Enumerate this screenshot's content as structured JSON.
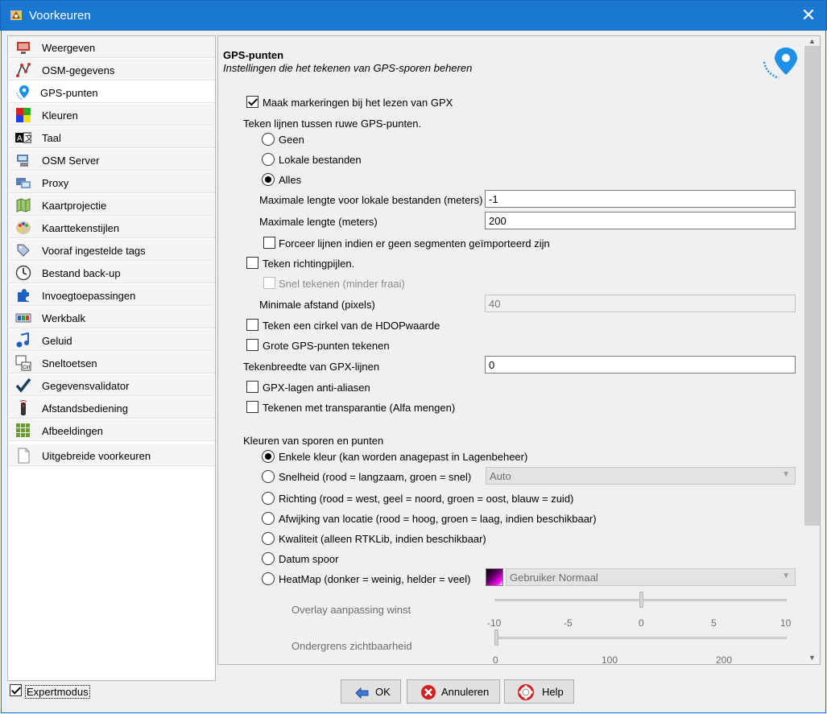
{
  "window": {
    "title": "Voorkeuren",
    "close_glyph": "✕"
  },
  "sidebar": {
    "items": [
      {
        "label": "Weergeven",
        "icon": "display-icon"
      },
      {
        "label": "OSM-gegevens",
        "icon": "osm-data-icon"
      },
      {
        "label": "GPS-punten",
        "icon": "gps-pin-icon"
      },
      {
        "label": "Kleuren",
        "icon": "colors-icon"
      },
      {
        "label": "Taal",
        "icon": "language-icon"
      },
      {
        "label": "OSM Server",
        "icon": "server-icon"
      },
      {
        "label": "Proxy",
        "icon": "proxy-icon"
      },
      {
        "label": "Kaartprojectie",
        "icon": "map-projection-icon"
      },
      {
        "label": "Kaarttekenstijlen",
        "icon": "palette-icon"
      },
      {
        "label": "Vooraf ingestelde tags",
        "icon": "tags-icon"
      },
      {
        "label": "Bestand back-up",
        "icon": "clock-icon"
      },
      {
        "label": "Invoegtoepassingen",
        "icon": "plugin-icon"
      },
      {
        "label": "Werkbalk",
        "icon": "toolbar-icon"
      },
      {
        "label": "Geluid",
        "icon": "sound-icon"
      },
      {
        "label": "Sneltoetsen",
        "icon": "shortcuts-icon"
      },
      {
        "label": "Gegevensvalidator",
        "icon": "validator-check-icon"
      },
      {
        "label": "Afstandsbediening",
        "icon": "remote-control-icon"
      },
      {
        "label": "Afbeeldingen",
        "icon": "imagery-grid-icon"
      },
      {
        "label": "Uitgebreide voorkeuren",
        "icon": "document-icon"
      }
    ],
    "selected": "GPS-punten"
  },
  "panel": {
    "title": "GPS-punten",
    "subtitle": "Instellingen die het tekenen van GPS-sporen beheren",
    "make_markers": "Maak markeringen bij het lezen van GPX",
    "draw_lines_heading": "Teken lijnen tussen ruwe GPS-punten.",
    "lines_none": "Geen",
    "lines_local": "Lokale bestanden",
    "lines_all": "Alles",
    "max_len_local_label": "Maximale lengte voor lokale bestanden (meters)",
    "max_len_local_value": "-1",
    "max_len_label": "Maximale lengte (meters)",
    "max_len_value": "200",
    "force_lines": "Forceer lijnen indien er geen segmenten geïmporteerd zijn",
    "draw_arrows": "Teken richtingpijlen.",
    "fast_draw": "Snel tekenen (minder fraai)",
    "min_dist_label": "Minimale afstand (pixels)",
    "min_dist_value": "40",
    "hdop_circle": "Teken een cirkel van de HDOPwaarde",
    "large_points": "Grote GPS-punten tekenen",
    "gpx_line_width_label": "Tekenbreedte van GPX-lijnen",
    "gpx_line_width_value": "0",
    "antialias": "GPX-lagen anti-aliasen",
    "alpha_blend": "Tekenen met transparantie (Alfa mengen)",
    "colors_heading": "Kleuren van sporen en punten",
    "color_single": "Enkele kleur (kan worden anagepast in Lagenbeheer)",
    "color_speed": "Snelheid (rood = langzaam, groen = snel)",
    "speed_select": "Auto",
    "color_direction": "Richting (rood = west, geel = noord, groen = oost, blauw = zuid)",
    "color_deviation": "Afwijking van locatie (rood = hoog, groen = laag, indien beschikbaar)",
    "color_quality": "Kwaliteit (alleen RTKLib, indien beschikbaar)",
    "color_date": "Datum spoor",
    "color_heatmap": "HeatMap (donker = weinig, helder = veel)",
    "heatmap_select": "Gebruiker Normaal",
    "overlay_label": "Overlay aanpassing winst",
    "overlay_ticks": [
      "-10",
      "-5",
      "0",
      "5",
      "10"
    ],
    "overlay_value": 0,
    "lower_label": "Ondergrens zichtbaarheid",
    "lower_ticks": [
      "0",
      "100",
      "200"
    ],
    "lower_value": 0
  },
  "footer": {
    "expert_mode": "Expertmodus",
    "ok": "OK",
    "cancel": "Annuleren",
    "help": "Help"
  },
  "colors": {
    "titlebar": "#1a78d2",
    "accent_blue": "#1e90e8"
  }
}
